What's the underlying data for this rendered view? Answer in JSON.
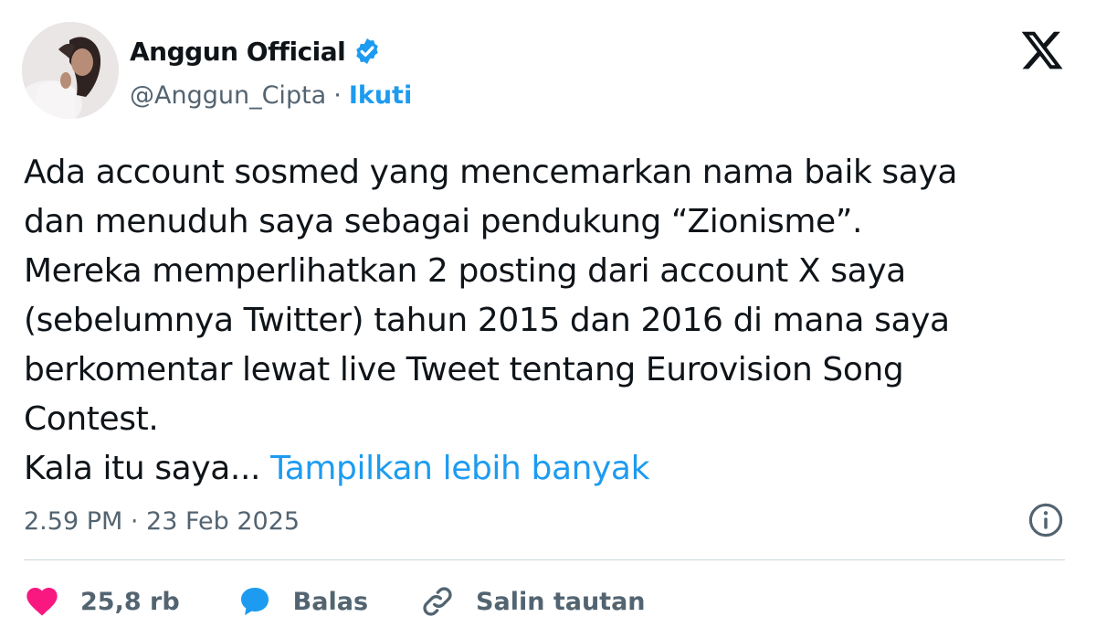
{
  "author": {
    "display_name": "Anggun Official",
    "handle": "@Anggun_Cipta",
    "separator": "·",
    "follow_label": "Ikuti",
    "verified": true
  },
  "post": {
    "lines": [
      "Ada account sosmed yang mencemarkan nama baik saya",
      "dan menuduh saya sebagai pendukung “Zionisme”.",
      "Mereka memperlihatkan 2 posting dari account X saya",
      "(sebelumnya Twitter) tahun 2015 dan 2016 di mana saya",
      "berkomentar lewat live Tweet tentang Eurovision Song",
      "Contest."
    ],
    "last_line_prefix": "Kala itu saya...",
    "show_more_label": "Tampilkan lebih banyak",
    "timestamp": "2.59 PM · 23 Feb 2025"
  },
  "actions": {
    "likes_count": "25,8 rb",
    "reply_label": "Balas",
    "copy_link_label": "Salin tautan"
  },
  "icons": {
    "logo": "x-logo-icon",
    "verified": "verified-badge-icon",
    "info": "info-icon",
    "like": "heart-icon",
    "reply": "reply-bubble-icon",
    "link": "link-icon"
  },
  "colors": {
    "accent": "#1d9bf0",
    "text_primary": "#0f1419",
    "text_secondary": "#536471",
    "like": "#f91880",
    "divider": "#cfd9de"
  }
}
